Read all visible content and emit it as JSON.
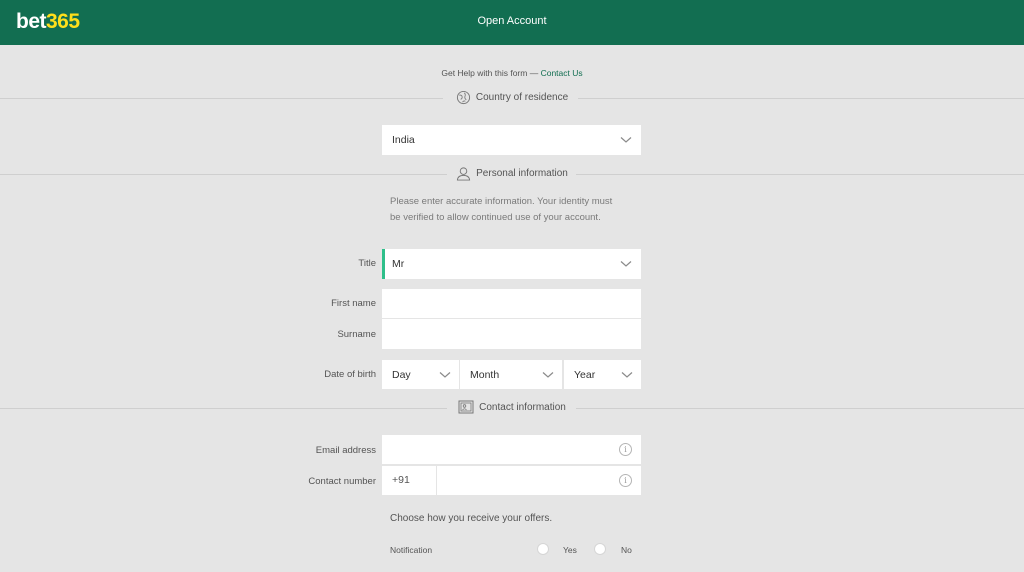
{
  "header": {
    "logo_part1": "bet",
    "logo_part2": "365",
    "title": "Open Account"
  },
  "help": {
    "text": "Get Help with this form —",
    "link": "Contact Us"
  },
  "country_section": {
    "label": "Country of residence",
    "value": "India"
  },
  "personal_section": {
    "label": "Personal information",
    "line1": "Please enter accurate information. Your identity must",
    "line2": "be verified to allow continued use of your account."
  },
  "form": {
    "title_label": "Title",
    "title_value": "Mr",
    "first_name_label": "First name",
    "surname_label": "Surname",
    "dob_label": "Date of birth",
    "dob_day": "Day",
    "dob_month": "Month",
    "dob_year": "Year"
  },
  "contact_section": {
    "label": "Contact information",
    "email_label": "Email address",
    "phone_label": "Contact number",
    "phone_prefix": "+91"
  },
  "offers": {
    "intro": "Choose how you receive your offers.",
    "notification_label": "Notification",
    "yes_label": "Yes",
    "no_label": "No"
  },
  "colors": {
    "header_bg": "#126e51",
    "logo_accent": "#ffdf1b",
    "title_focus_bar": "#2ebf8a"
  },
  "icons": [
    "globe-icon",
    "person-icon",
    "contact-card-icon",
    "chevron-down-icon",
    "info-icon"
  ]
}
